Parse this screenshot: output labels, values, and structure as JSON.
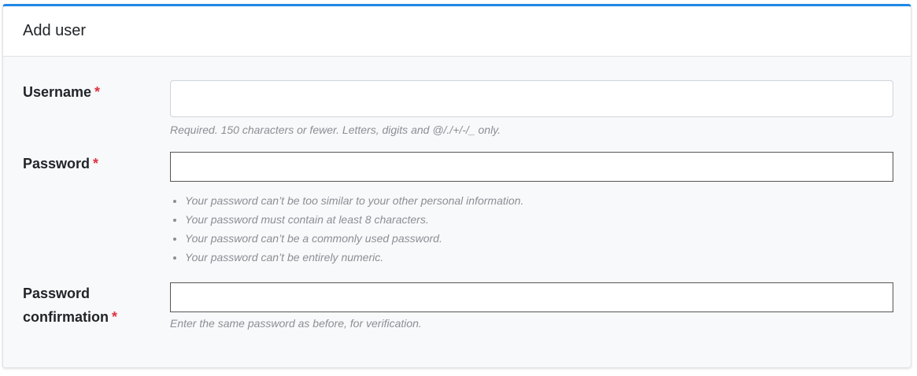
{
  "card": {
    "title": "Add user"
  },
  "form": {
    "required_marker": "*",
    "username": {
      "label": "Username",
      "value": "",
      "help": "Required. 150 characters or fewer. Letters, digits and @/./+/-/_ only."
    },
    "password": {
      "label": "Password",
      "value": "",
      "help_items": [
        "Your password can’t be too similar to your other personal information.",
        "Your password must contain at least 8 characters.",
        "Your password can’t be a commonly used password.",
        "Your password can’t be entirely numeric."
      ]
    },
    "password_confirmation": {
      "label_line1": "Password",
      "label_line2": "confirmation",
      "value": "",
      "help": "Enter the same password as before, for verification."
    }
  },
  "colors": {
    "accent": "#1e88e5",
    "required": "#dc3545",
    "help_text": "#8a8f95"
  }
}
